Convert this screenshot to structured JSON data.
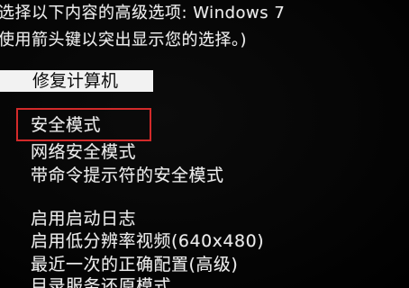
{
  "header": {
    "line1": "选择以下内容的高级选项: Windows 7",
    "line2": "使用箭头键以突出显示您的选择。)"
  },
  "menu": {
    "selected": "修复计算机",
    "items": [
      "安全模式",
      "网络安全模式",
      "带命令提示符的安全模式",
      "启用启动日志",
      "启用低分辨率视频(640x480)",
      "最近一次的正确配置(高级)",
      "目录服务还原模式"
    ]
  },
  "colors": {
    "background": "#000000",
    "text": "#ececec",
    "highlight_bar": "#f2f2f2",
    "annotation_box": "#d32a2a"
  }
}
